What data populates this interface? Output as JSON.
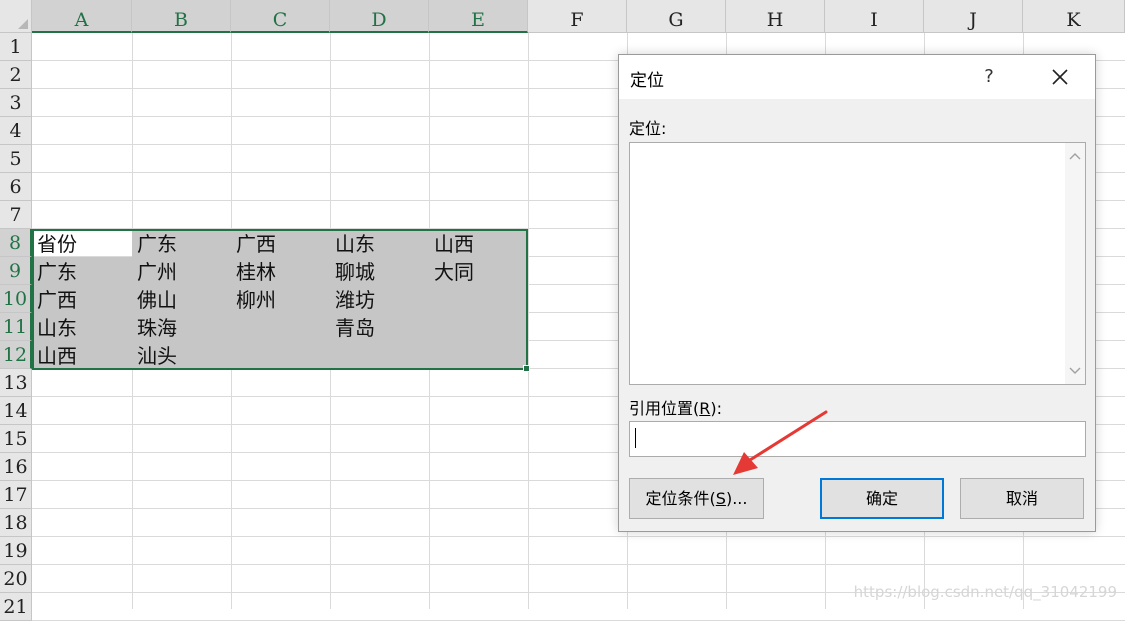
{
  "sheet": {
    "columns": [
      "A",
      "B",
      "C",
      "D",
      "E",
      "F",
      "G",
      "H",
      "I",
      "J",
      "K"
    ],
    "rows": [
      "1",
      "2",
      "3",
      "4",
      "5",
      "6",
      "7",
      "8",
      "9",
      "10",
      "11",
      "12",
      "13",
      "14",
      "15",
      "16",
      "17",
      "18",
      "19",
      "20",
      "21"
    ],
    "cells": [
      [
        "省份",
        "广东",
        "广西",
        "山东",
        "山西"
      ],
      [
        "广东",
        "广州",
        "桂林",
        "聊城",
        "大同"
      ],
      [
        "广西",
        "佛山",
        "柳州",
        "潍坊",
        ""
      ],
      [
        "山东",
        "珠海",
        "",
        "青岛",
        ""
      ],
      [
        "山西",
        "汕头",
        "",
        "",
        ""
      ]
    ]
  },
  "dialog": {
    "title": "定位",
    "help": "?",
    "goto_label": "定位:",
    "reference_label": "引用位置(R):",
    "reference_value": "",
    "special_button": "定位条件(S)...",
    "ok_button": "确定",
    "cancel_button": "取消"
  },
  "watermark": "https://blog.csdn.net/qq_31042199",
  "colors": {
    "selection_border": "#217346",
    "selection_fill": "#c6c6c6",
    "arrow": "#e53935",
    "ok_border": "#0078d7"
  }
}
